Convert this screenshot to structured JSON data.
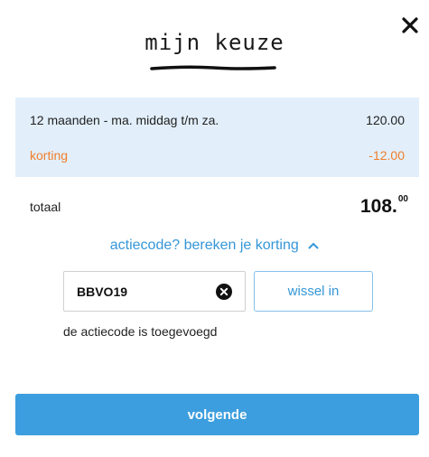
{
  "dialog": {
    "title": "mijn keuze",
    "close_icon": "close-icon"
  },
  "summary": {
    "line_label": "12 maanden - ma. middag t/m za.",
    "line_value": "120.00",
    "discount_label": "korting",
    "discount_value": "-12.00",
    "discount_color": "#f07d2a",
    "background_color": "#e2effb"
  },
  "total": {
    "label": "totaal",
    "value_main": "108.",
    "value_cents": "00"
  },
  "promo": {
    "toggle_label": "actiecode? bereken je korting",
    "toggle_icon": "chevron-up-icon",
    "code_value": "BBVO19",
    "clear_icon": "clear-circle-icon",
    "redeem_label": "wissel in",
    "status_text": "de actiecode is toegevoegd",
    "accent_color": "#3597d8"
  },
  "footer": {
    "next_label": "volgende",
    "button_color": "#3c9ede"
  }
}
